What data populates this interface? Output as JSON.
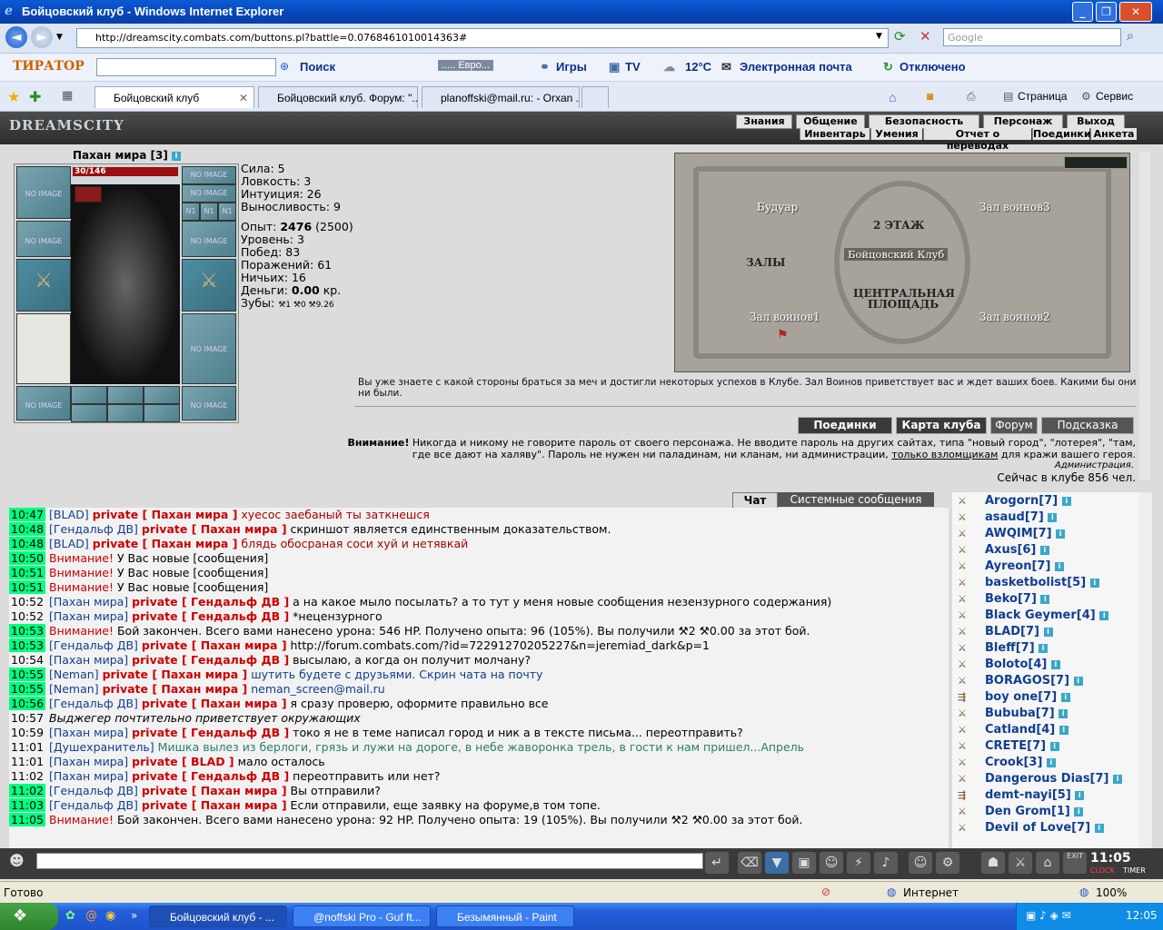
{
  "window": {
    "title": "Бойцовский клуб - Windows Internet Explorer"
  },
  "address": {
    "url": "http://dreamscity.combats.com/buttons.pl?battle=0.0768461010014363#",
    "search_placeholder": "Google"
  },
  "toolbar": {
    "logo": "ТИРАТОР",
    "search_label": "Поиск",
    "radio_label": "..... Евро...",
    "games": "Игры",
    "tv": "TV",
    "weather": "12°C",
    "email": "Электронная почта",
    "status": "Отключено"
  },
  "tabs": [
    {
      "label": "Бойцовский клуб"
    },
    {
      "label": "Бойцовский клуб. Форум: \"..."
    },
    {
      "label": "planoffski@mail.ru: - Orxan ..."
    }
  ],
  "commands": {
    "page": "Страница",
    "service": "Сервис"
  },
  "game": {
    "logo": "DREAMSCITY",
    "menu_top": [
      "Знания",
      "Общение",
      "Безопасность",
      "Персонаж",
      "Выход"
    ],
    "menu_bottom": [
      "Инвентарь",
      "Умения",
      "Отчет о переводах",
      "Поединки",
      "Анкета"
    ],
    "character": {
      "name": "Пахан мира [3]",
      "hp": "30/146",
      "slot_text": "NO IMAGE",
      "n1": "N1"
    },
    "stats": {
      "strength": "Сила: 5",
      "agility": "Ловкость: 3",
      "intuition": "Интуиция: 26",
      "endurance": "Выносливость: 9",
      "exp_label": "Опыт:",
      "exp_value": "2476",
      "exp_next": "(2500)",
      "level": "Уровень: 3",
      "wins": "Побед: 83",
      "losses": "Поражений: 61",
      "draws": "Ничьих: 16",
      "money_label": "Деньги:",
      "money_value": "0.00",
      "money_unit": "кр.",
      "teeth_label": "Зубы:",
      "teeth": [
        "1",
        "0",
        "9.26"
      ]
    },
    "map": {
      "rooms": {
        "boudoir": "Будуар",
        "floor2": "2 ЭТАЖ",
        "hall3": "Зал воинов3",
        "club": "Бойцовский Клуб",
        "halls": "ЗАЛЫ",
        "central": "ЦЕНТРАЛЬНАЯ ПЛОЩАДЬ",
        "hall1": "Зал воинов1",
        "hall2": "Зал воинов2"
      },
      "description": "Вы уже знаете с какой стороны браться за меч и достигли некоторых успехов в Клубе. Зал Воинов приветствует вас и ждет ваших боев. Какими бы они ни были."
    },
    "buttons": {
      "duels": "Поединки",
      "club_map": "Карта клуба",
      "forum": "Форум",
      "hint": "Подсказка"
    },
    "warning": {
      "bold": "Внимание!",
      "text1": "Никогда и никому не говорите пароль от своего персонажа. Не вводите пароль на других сайтах, типа \"новый город\", \"лотерея\", \"там, где все дают на халяву\". Пароль не нужен ни паладинам, ни кланам, ни администрации,",
      "link": "только взломщикам",
      "text2": "для кражи вашего героя.",
      "admin": "Администрация."
    },
    "online": "Сейчас в клубе 856 чел.",
    "chat_tabs": {
      "chat": "Чат",
      "system": "Системные сообщения"
    },
    "chat": [
      {
        "time": "10:47",
        "hl": true,
        "from": "[BLAD]",
        "priv": "private [ Пахан мира ]",
        "text": "хуесос заебаный ты заткнешся",
        "cls": "red"
      },
      {
        "time": "10:48",
        "hl": true,
        "from": "[Гендальф ДВ]",
        "priv": "private [ Пахан мира ]",
        "text": "скриншот является единственным доказательством.",
        "cls": ""
      },
      {
        "time": "10:48",
        "hl": true,
        "from": "[BLAD]",
        "priv": "private [ Пахан мира ]",
        "text": "блядь обосраная соси хуй и нетявкай",
        "cls": "red"
      },
      {
        "time": "10:50",
        "hl": true,
        "warn": "Внимание!",
        "text": "У Вас новые [сообщения]",
        "cls": ""
      },
      {
        "time": "10:51",
        "hl": true,
        "warn": "Внимание!",
        "text": "У Вас новые [сообщения]",
        "cls": ""
      },
      {
        "time": "10:51",
        "hl": true,
        "warn": "Внимание!",
        "text": "У Вас новые [сообщения]",
        "cls": ""
      },
      {
        "time": "10:52",
        "hl": false,
        "from": "[Пахан мира]",
        "priv": "private [ Гендальф ДВ ]",
        "text": "а на какое мыло посылать? а то тут у меня новые сообщения незензурного содержания)",
        "cls": ""
      },
      {
        "time": "10:52",
        "hl": false,
        "from": "[Пахан мира]",
        "priv": "private [ Гендальф ДВ ]",
        "text": "*нецензурного",
        "cls": ""
      },
      {
        "time": "10:53",
        "hl": true,
        "warn": "Внимание!",
        "text": "Бой закончен. Всего вами нанесено урона: 546 HP. Получено опыта: 96 (105%). Вы получили ⚒2 ⚒0.00 за этот бой.",
        "cls": ""
      },
      {
        "time": "10:53",
        "hl": true,
        "from": "[Гендальф ДВ]",
        "priv": "private [ Пахан мира ]",
        "text": "http://forum.combats.com/?id=72291270205227&n=jeremiad_dark&p=1",
        "cls": ""
      },
      {
        "time": "10:54",
        "hl": false,
        "from": "[Пахан мира]",
        "priv": "private [ Гендальф ДВ ]",
        "text": "высылаю, а когда он получит молчану?",
        "cls": ""
      },
      {
        "time": "10:55",
        "hl": true,
        "from": "[Neman]",
        "priv": "private [ Пахан мира ]",
        "text": "шутить будете с друзьями. Скрин чата на почту",
        "cls": "blue"
      },
      {
        "time": "10:55",
        "hl": true,
        "from": "[Neman]",
        "priv": "private [ Пахан мира ]",
        "text": "neman_screen@mail.ru",
        "cls": "blue"
      },
      {
        "time": "10:56",
        "hl": true,
        "from": "[Гендальф ДВ]",
        "priv": "private [ Пахан мира ]",
        "text": "я сразу проверю, оформите правильно все",
        "cls": ""
      },
      {
        "time": "10:57",
        "hl": false,
        "em": "Выджегер почтительно приветствует окружающих",
        "cls": ""
      },
      {
        "time": "10:59",
        "hl": false,
        "from": "[Пахан мира]",
        "priv": "private [ Гендальф ДВ ]",
        "text": "токо я не в теме написал город и ник а в тексте письма... переотправить?",
        "cls": ""
      },
      {
        "time": "11:01",
        "hl": false,
        "from": "[Душехранитель]",
        "text": "Мишка вылез из берлоги, грязь и лужи на дороге, в небе жаворонка трель, в гости к нам пришел...Апрель",
        "cls": "green"
      },
      {
        "time": "11:01",
        "hl": false,
        "from": "[Пахан мира]",
        "priv": "private [ BLAD ]",
        "text": "мало осталось",
        "cls": ""
      },
      {
        "time": "11:02",
        "hl": false,
        "from": "[Пахан мира]",
        "priv": "private [ Гендальф ДВ ]",
        "text": "переотправить или нет?",
        "cls": ""
      },
      {
        "time": "11:02",
        "hl": true,
        "from": "[Гендальф ДВ]",
        "priv": "private [ Пахан мира ]",
        "text": "Вы отправили?",
        "cls": ""
      },
      {
        "time": "11:03",
        "hl": true,
        "from": "[Гендальф ДВ]",
        "priv": "private [ Пахан мира ]",
        "text": "Если отправили, еще заявку на форуме,в том топе.",
        "cls": ""
      },
      {
        "time": "11:05",
        "hl": true,
        "warn": "Внимание!",
        "text": "Бой закончен. Всего вами нанесено урона: 92 HP. Получено опыта: 19 (105%). Вы получили ⚒2 ⚒0.00 за этот бой.",
        "cls": ""
      }
    ],
    "users": [
      "Arogorn[7]",
      "asaud[7]",
      "AWQIM[7]",
      "Axus[6]",
      "Ayreon[7]",
      "basketbolist[5]",
      "Beko[7]",
      "Black Geymer[4]",
      "BLAD[7]",
      "Bleff[7]",
      "Boloto[4]",
      "BORAGOS[7]",
      "boy one[7]",
      "Bububa[7]",
      "Catland[4]",
      "CRETE[7]",
      "Crook[3]",
      "Dangerous Dias[7]",
      "demt-nayi[5]",
      "Den Grom[1]",
      "Devil of Love[7]"
    ],
    "clock": "11:05",
    "clock_labels": {
      "clock": "CLOCK",
      "timer": "TIMER",
      "exit": "EXIT"
    }
  },
  "statusbar": {
    "ready": "Готово",
    "zone": "Интернет",
    "zoom": "100%"
  },
  "taskbar": {
    "tasks": [
      "Бойцовский клуб - ...",
      "@noffski Pro - Guf ft...",
      "Безымянный - Paint"
    ],
    "time": "12:05"
  }
}
